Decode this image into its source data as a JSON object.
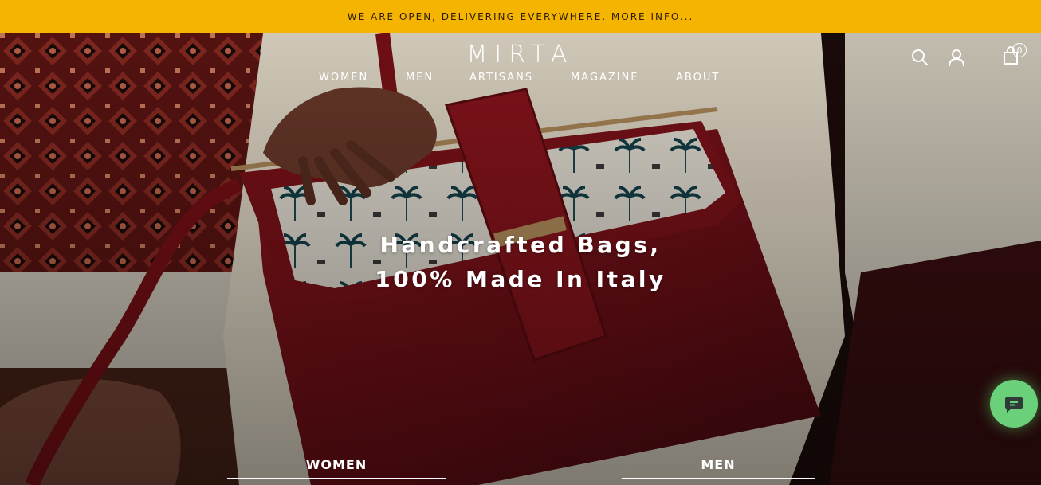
{
  "announcement": {
    "text": "WE ARE OPEN, DELIVERING EVERYWHERE. MORE INFO..."
  },
  "header": {
    "logo": "MIRTA",
    "nav": [
      {
        "label": "WOMEN"
      },
      {
        "label": "MEN"
      },
      {
        "label": "ARTISANS"
      },
      {
        "label": "MAGAZINE"
      },
      {
        "label": "ABOUT"
      }
    ],
    "icons": {
      "search": "search-icon",
      "account": "user-icon",
      "cart": "shopping-bag-icon"
    },
    "cart_count": "0"
  },
  "hero": {
    "headline_line1": "Handcrafted Bags,",
    "headline_line2": "100% Made In Italy"
  },
  "categories": [
    {
      "label": "WOMEN"
    },
    {
      "label": "MEN"
    }
  ],
  "chat": {
    "icon": "chat-bubble-icon",
    "color": "#6bd07a"
  },
  "colors": {
    "announcement_bg": "#f5b400",
    "bag_red": "#7a1016"
  }
}
